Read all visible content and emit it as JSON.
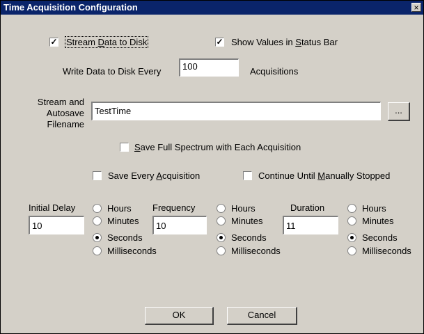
{
  "window": {
    "title": "Time Acquisition Configuration",
    "close_glyph": "×"
  },
  "stream_to_disk": {
    "label_a": "Stream ",
    "label_u": "D",
    "label_b": "ata to Disk",
    "checked": true,
    "mark": "✓"
  },
  "show_values": {
    "label_a": "Show Values in ",
    "label_u": "S",
    "label_b": "tatus Bar",
    "checked": true,
    "mark": "✓"
  },
  "write_every": {
    "label": "Write Data to Disk Every",
    "value": "100",
    "suffix": "Acquisitions"
  },
  "filename": {
    "label_line1": "Stream and",
    "label_line2": "Autosave",
    "label_line3": "Filename",
    "value": "TestTime",
    "browse_label": "..."
  },
  "save_full_spectrum": {
    "label_a": "",
    "label_u": "S",
    "label_b": "ave Full Spectrum with Each Acquisition",
    "checked": false
  },
  "save_every": {
    "label_a": "Save Every ",
    "label_u": "A",
    "label_b": "cquisition",
    "checked": false
  },
  "continue_until": {
    "label_a": "Continue Until ",
    "label_u": "M",
    "label_b": "anually Stopped",
    "checked": false
  },
  "initial_delay": {
    "label": "Initial Delay",
    "value": "10",
    "options": [
      "Hours",
      "Minutes",
      "Seconds",
      "Milliseconds"
    ],
    "selected": "Seconds"
  },
  "frequency": {
    "label": "Frequency",
    "value": "10",
    "options": [
      "Hours",
      "Minutes",
      "Seconds",
      "Milliseconds"
    ],
    "selected": "Seconds"
  },
  "duration": {
    "label": "Duration",
    "value": "11",
    "options": [
      "Hours",
      "Minutes",
      "Seconds",
      "Milliseconds"
    ],
    "selected": "Seconds"
  },
  "buttons": {
    "ok": "OK",
    "cancel": "Cancel"
  },
  "colors": {
    "titlebar": "#0a246a",
    "face": "#d4d0c8"
  }
}
